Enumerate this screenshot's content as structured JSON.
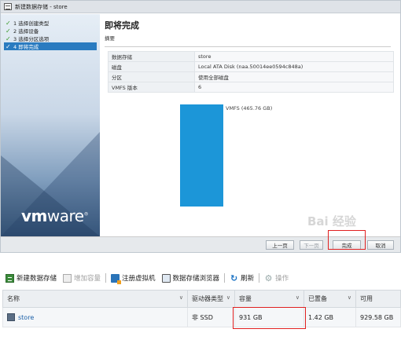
{
  "wizard": {
    "title": "新建数据存储 - store",
    "steps": [
      {
        "label": "1 选择创建类型",
        "done": true
      },
      {
        "label": "2 选择设备",
        "done": true
      },
      {
        "label": "3 选择分区选项",
        "done": true
      },
      {
        "label": "4 即将完成",
        "done": true,
        "active": true
      }
    ],
    "heading": "即将完成",
    "subheading": "摘要",
    "summary": [
      {
        "key": "数据存储",
        "value": "store"
      },
      {
        "key": "磁盘",
        "value": "Local ATA Disk (naa.50014ee0594c848a)"
      },
      {
        "key": "分区",
        "value": "使用全部磁盘"
      },
      {
        "key": "VMFS 版本",
        "value": "6"
      }
    ],
    "disk_label": "VMFS (465.76 GB)",
    "brand": "vmware",
    "buttons": {
      "prev": "上一页",
      "next": "下一页",
      "finish": "完成",
      "cancel": "取消"
    },
    "watermark": "Bai 经验"
  },
  "toolbar": {
    "new_datastore": "新建数据存储",
    "add_capacity": "增加容量",
    "register_vm": "注册虚拟机",
    "browser": "数据存储浏览器",
    "refresh": "刷新",
    "actions": "操作"
  },
  "table": {
    "columns": [
      "名称",
      "驱动器类型",
      "容量",
      "已置备",
      "可用"
    ],
    "rows": [
      {
        "name": "store",
        "drive_type": "非 SSD",
        "capacity": "931 GB",
        "provisioned": "1.42 GB",
        "free": "929.58 GB"
      }
    ]
  },
  "colors": {
    "accent": "#2a7bc0",
    "disk_bar": "#1c96d8",
    "highlight": "#e02020"
  }
}
